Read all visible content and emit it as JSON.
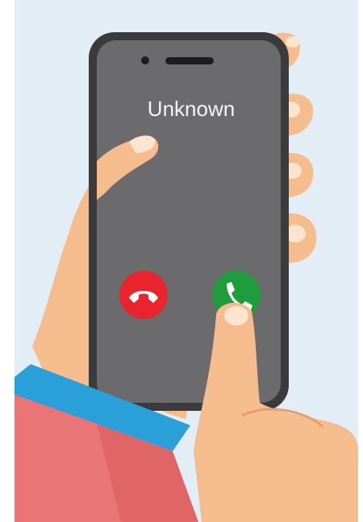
{
  "call": {
    "caller_name": "Unknown",
    "decline_icon": "phone-hangup-icon",
    "accept_icon": "phone-answer-icon"
  },
  "colors": {
    "background": "#e3edf5",
    "phone_body": "#3b3b3d",
    "phone_screen": "#6b6b6e",
    "decline": "#e8242c",
    "accept": "#1f9c3b",
    "skin": "#f5bd8e",
    "skin_shadow": "#e49e6c",
    "sleeve_cuff": "#2a9fd8",
    "sleeve": "#e06566"
  }
}
